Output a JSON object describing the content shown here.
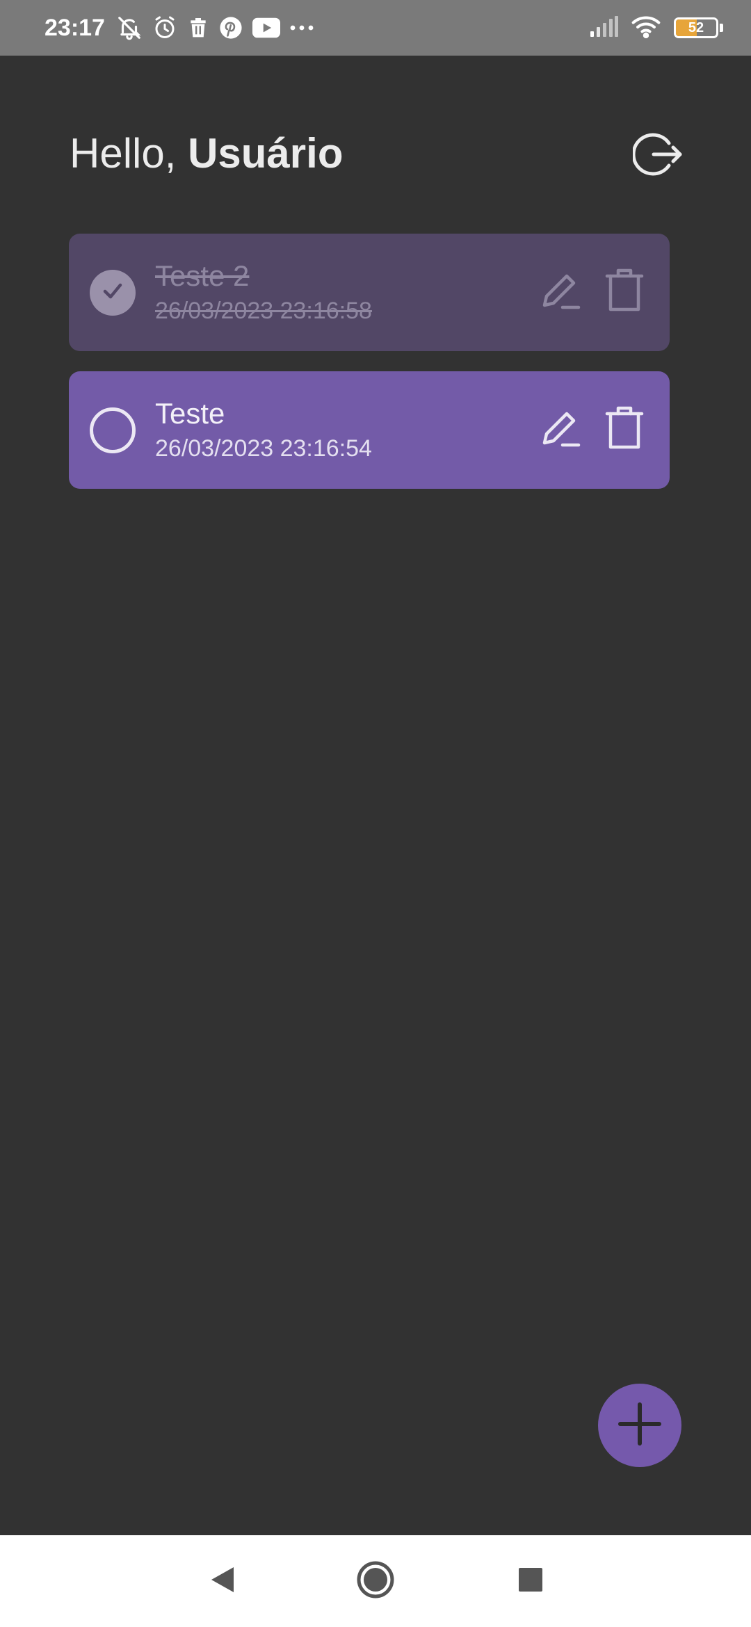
{
  "status_bar": {
    "time": "23:17",
    "battery_level": 52,
    "battery_label": "52",
    "icons": [
      "mute-bell-icon",
      "alarm-icon",
      "trash-notification-icon",
      "pinterest-icon",
      "youtube-icon",
      "more-dots-icon",
      "signal-icon",
      "wifi-icon",
      "battery-icon"
    ]
  },
  "header": {
    "greeting": "Hello, ",
    "user_name": "Usuário",
    "logout_icon": "logout-icon"
  },
  "tasks": [
    {
      "title": "Teste 2",
      "date": "26/03/2023 23:16:58",
      "completed": true
    },
    {
      "title": "Teste",
      "date": "26/03/2023 23:16:54",
      "completed": false
    }
  ],
  "fab": {
    "icon": "plus-icon"
  },
  "nav_bar": {
    "icons": [
      "back-icon",
      "home-icon",
      "recents-icon"
    ]
  },
  "colors": {
    "background": "#323232",
    "status_bar": "#7a7a7a",
    "task_done": "#524766",
    "task_open": "#735ba8",
    "accent": "#7559ac",
    "battery": "#e7a53a"
  }
}
